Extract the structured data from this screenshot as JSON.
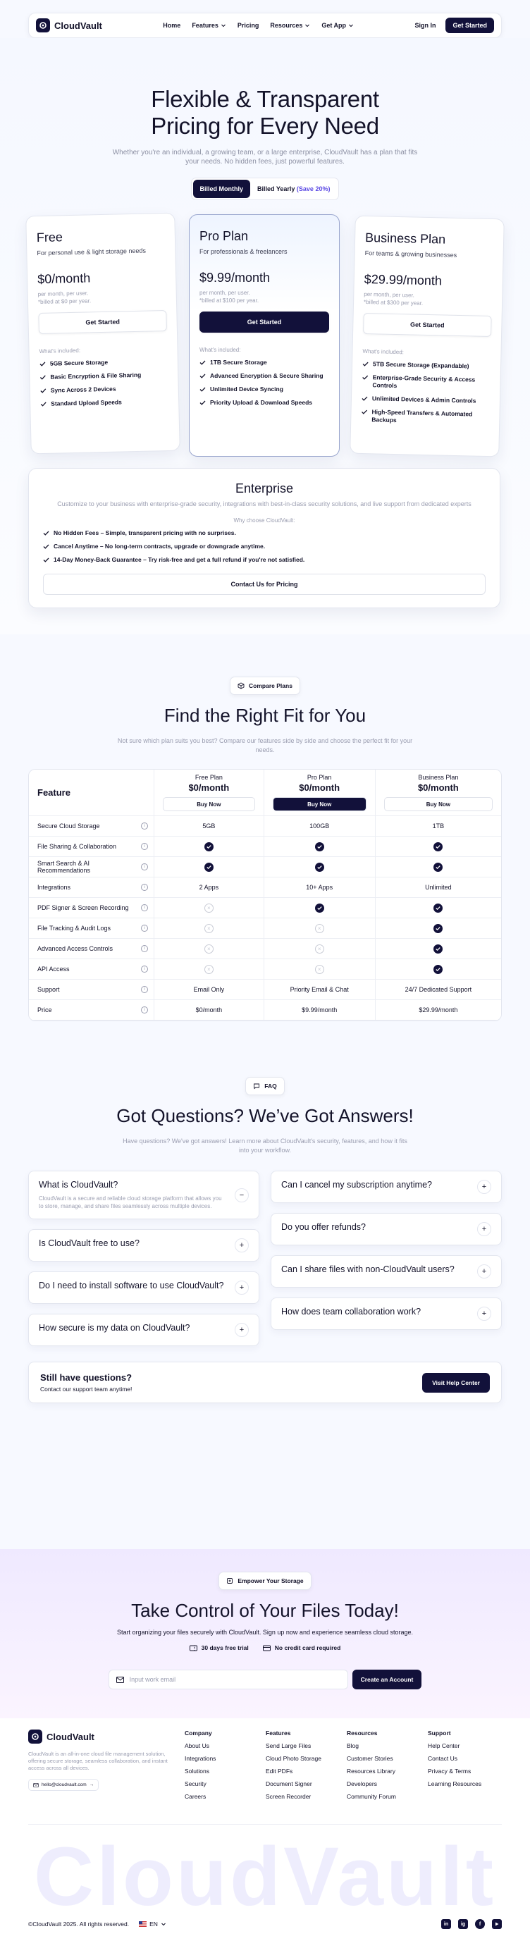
{
  "nav": {
    "brand": "CloudVault",
    "links": [
      "Home",
      "Features",
      "Pricing",
      "Resources",
      "Get App"
    ],
    "signin": "Sign In",
    "cta": "Get Started"
  },
  "hero": {
    "title_l1": "Flexible & Transparent",
    "title_l2": "Pricing for Every Need",
    "subtitle": "Whether you're an individual, a growing team, or a large enterprise, CloudVault has a plan that fits your needs. No hidden fees, just powerful features.",
    "billing_monthly": "Billed Monthly",
    "billing_yearly": "Billed Yearly",
    "save": "(Save 20%)"
  },
  "plans": {
    "free": {
      "name": "Free",
      "sub": "For personal use & light storage needs",
      "price": "$0/month",
      "small1": "per month, per user.",
      "small2": "*billed at $0 per year.",
      "cta": "Get Started",
      "inc": "What's included:",
      "features": [
        "5GB Secure Storage",
        "Basic Encryption & File Sharing",
        "Sync Across 2 Devices",
        "Standard Upload Speeds"
      ]
    },
    "pro": {
      "name": "Pro Plan",
      "sub": "For professionals & freelancers",
      "price": "$9.99/month",
      "small1": "per month, per user.",
      "small2": "*billed at $100 per year.",
      "cta": "Get Started",
      "inc": "What's included:",
      "features": [
        "1TB Secure Storage",
        "Advanced Encryption & Secure Sharing",
        "Unlimited Device Syncing",
        "Priority Upload & Download Speeds"
      ]
    },
    "business": {
      "name": "Business Plan",
      "sub": "For teams & growing businesses",
      "price": "$29.99/month",
      "small1": "per month, per user.",
      "small2": "*billed at $300 per year.",
      "cta": "Get Started",
      "inc": "What's included:",
      "features": [
        "5TB Secure Storage (Expandable)",
        "Enterprise-Grade Security & Access Controls",
        "Unlimited Devices & Admin Controls",
        "High-Speed Transfers & Automated Backups"
      ]
    }
  },
  "enterprise": {
    "name": "Enterprise",
    "desc": "Customize to your business with enterprise-grade security, integrations with best-in-class security solutions, and live support from dedicated experts",
    "why": "Why choose CloudVault:",
    "f1b": "No Hidden Fees",
    "f1": " – Simple, transparent pricing with no surprises.",
    "f2b": "Cancel Anytime",
    "f2": " – No long-term contracts, upgrade or downgrade anytime.",
    "f3b": "14-Day Money-Back Guarantee",
    "f3": " – Try risk-free and get a full refund if you're not satisfied.",
    "cta": "Contact Us for Pricing"
  },
  "compare": {
    "pill": "Compare Plans",
    "title": "Find the Right Fit for You",
    "lead": "Not sure which plan suits you best? Compare our features side by side and choose the perfect fit for your needs.",
    "feature_header": "Feature",
    "cols": [
      {
        "name": "Free Plan",
        "price": "$0/month",
        "cta": "Buy Now"
      },
      {
        "name": "Pro Plan",
        "price": "$0/month",
        "cta": "Buy Now"
      },
      {
        "name": "Business Plan",
        "price": "$0/month",
        "cta": "Buy Now"
      }
    ],
    "rows": [
      {
        "f": "Secure Cloud Storage",
        "v": [
          "5GB",
          "100GB",
          "1TB"
        ]
      },
      {
        "f": "File Sharing & Collaboration",
        "v": [
          "#check",
          "#check",
          "#check"
        ]
      },
      {
        "f": "Smart Search & AI Recommendations",
        "v": [
          "#check",
          "#check",
          "#check"
        ]
      },
      {
        "f": "Integrations",
        "v": [
          "2 Apps",
          "10+ Apps",
          "Unlimited"
        ]
      },
      {
        "f": "PDF Signer & Screen Recording",
        "v": [
          "#x",
          "#check",
          "#check"
        ]
      },
      {
        "f": "File Tracking & Audit Logs",
        "v": [
          "#x",
          "#x",
          "#check"
        ]
      },
      {
        "f": "Advanced Access Controls",
        "v": [
          "#x",
          "#x",
          "#check"
        ]
      },
      {
        "f": "API Access",
        "v": [
          "#x",
          "#x",
          "#check"
        ]
      },
      {
        "f": "Support",
        "v": [
          "Email Only",
          "Priority Email & Chat",
          "24/7 Dedicated Support"
        ]
      },
      {
        "f": "Price",
        "v": [
          "$0/month",
          "$9.99/month",
          "$29.99/month"
        ]
      }
    ]
  },
  "faq": {
    "pill": "FAQ",
    "title": "Got Questions? We’ve Got Answers!",
    "lead": "Have questions? We've got answers! Learn more about CloudVault's security, features, and how it fits into your workflow.",
    "left": [
      {
        "q": "What is CloudVault?",
        "a": "CloudVault is a secure and reliable cloud storage platform that allows you to store, manage, and share files seamlessly across multiple devices.",
        "open": true
      },
      {
        "q": "Is CloudVault free to use?"
      },
      {
        "q": "Do I need to install software to use CloudVault?"
      },
      {
        "q": "How secure is my data on CloudVault?"
      }
    ],
    "right": [
      {
        "q": "Can I cancel my subscription anytime?"
      },
      {
        "q": "Do you offer refunds?"
      },
      {
        "q": "Can I share files with non-CloudVault users?"
      },
      {
        "q": "How does team collaboration work?"
      }
    ],
    "still_title": "Still have questions?",
    "still_sub": "Contact our support team anytime!",
    "still_cta": "Visit Help Center"
  },
  "cta": {
    "pill": "Empower Your Storage",
    "title": "Take Control of Your Files Today!",
    "lead": "Start organizing your files securely with CloudVault. Sign up now and experience seamless cloud storage.",
    "t1": "30 days free trial",
    "t2": "No credit card required",
    "placeholder": "Input work email",
    "button": "Create an Account"
  },
  "footer": {
    "brand": "CloudVault",
    "desc": "CloudVault is an all-in-one cloud file management solution, offering secure storage, seamless collaboration, and instant access across all devices.",
    "email": "hello@cloudvault.com",
    "cols": [
      {
        "h": "Company",
        "items": [
          "About Us",
          "Integrations",
          "Solutions",
          "Security",
          "Careers"
        ]
      },
      {
        "h": "Features",
        "items": [
          "Send Large Files",
          "Cloud Photo Storage",
          "Edit PDFs",
          "Document Signer",
          "Screen Recorder"
        ]
      },
      {
        "h": "Resources",
        "items": [
          "Blog",
          "Customer Stories",
          "Resources Library",
          "Developers",
          "Community Forum"
        ]
      },
      {
        "h": "Support",
        "items": [
          "Help Center",
          "Contact Us",
          "Privacy & Terms",
          "Learning Resources"
        ]
      }
    ],
    "big": "CloudVault",
    "copyright": "©CloudVault 2025. All rights reserved.",
    "lang": "EN",
    "social": [
      "in",
      "ig",
      "f",
      "yt"
    ]
  },
  "colors": {
    "primary": "#12113a",
    "accent": "#5c4ae4"
  }
}
